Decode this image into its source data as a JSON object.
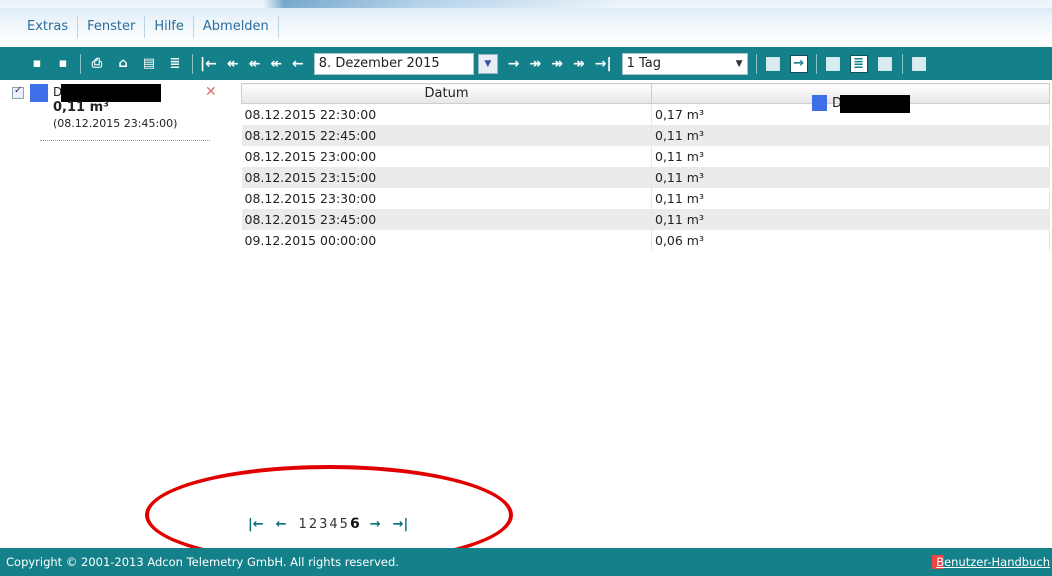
{
  "menu": {
    "items": [
      {
        "label": "Extras"
      },
      {
        "label": "Fenster"
      },
      {
        "label": "Hilfe"
      },
      {
        "label": "Abmelden"
      }
    ]
  },
  "toolbar": {
    "date_value": "8. Dezember 2015",
    "range_value": "1 Tag",
    "accent": "#14818a"
  },
  "sidebar": {
    "item_name": "D",
    "item_value": "0,11 m³",
    "item_timestamp": "(08.12.2015 23:45:00)",
    "swatch_color": "#3e6ee8"
  },
  "table": {
    "columns": [
      "Datum",
      "D"
    ],
    "rows": [
      {
        "date": "08.12.2015 22:30:00",
        "value": "0,17 m³"
      },
      {
        "date": "08.12.2015 22:45:00",
        "value": "0,11 m³"
      },
      {
        "date": "08.12.2015 23:00:00",
        "value": "0,11 m³"
      },
      {
        "date": "08.12.2015 23:15:00",
        "value": "0,11 m³"
      },
      {
        "date": "08.12.2015 23:30:00",
        "value": "0,11 m³"
      },
      {
        "date": "08.12.2015 23:45:00",
        "value": "0,11 m³"
      },
      {
        "date": "09.12.2015 00:00:00",
        "value": "0,06 m³"
      }
    ]
  },
  "pager": {
    "pages": [
      "1",
      "2",
      "3",
      "4",
      "5",
      "6"
    ],
    "current": "6"
  },
  "footer": {
    "copyright": "Copyright © 2001-2013 Adcon Telemetry GmbH. All rights reserved.",
    "manual_label": "Benutzer-Handbuch"
  }
}
